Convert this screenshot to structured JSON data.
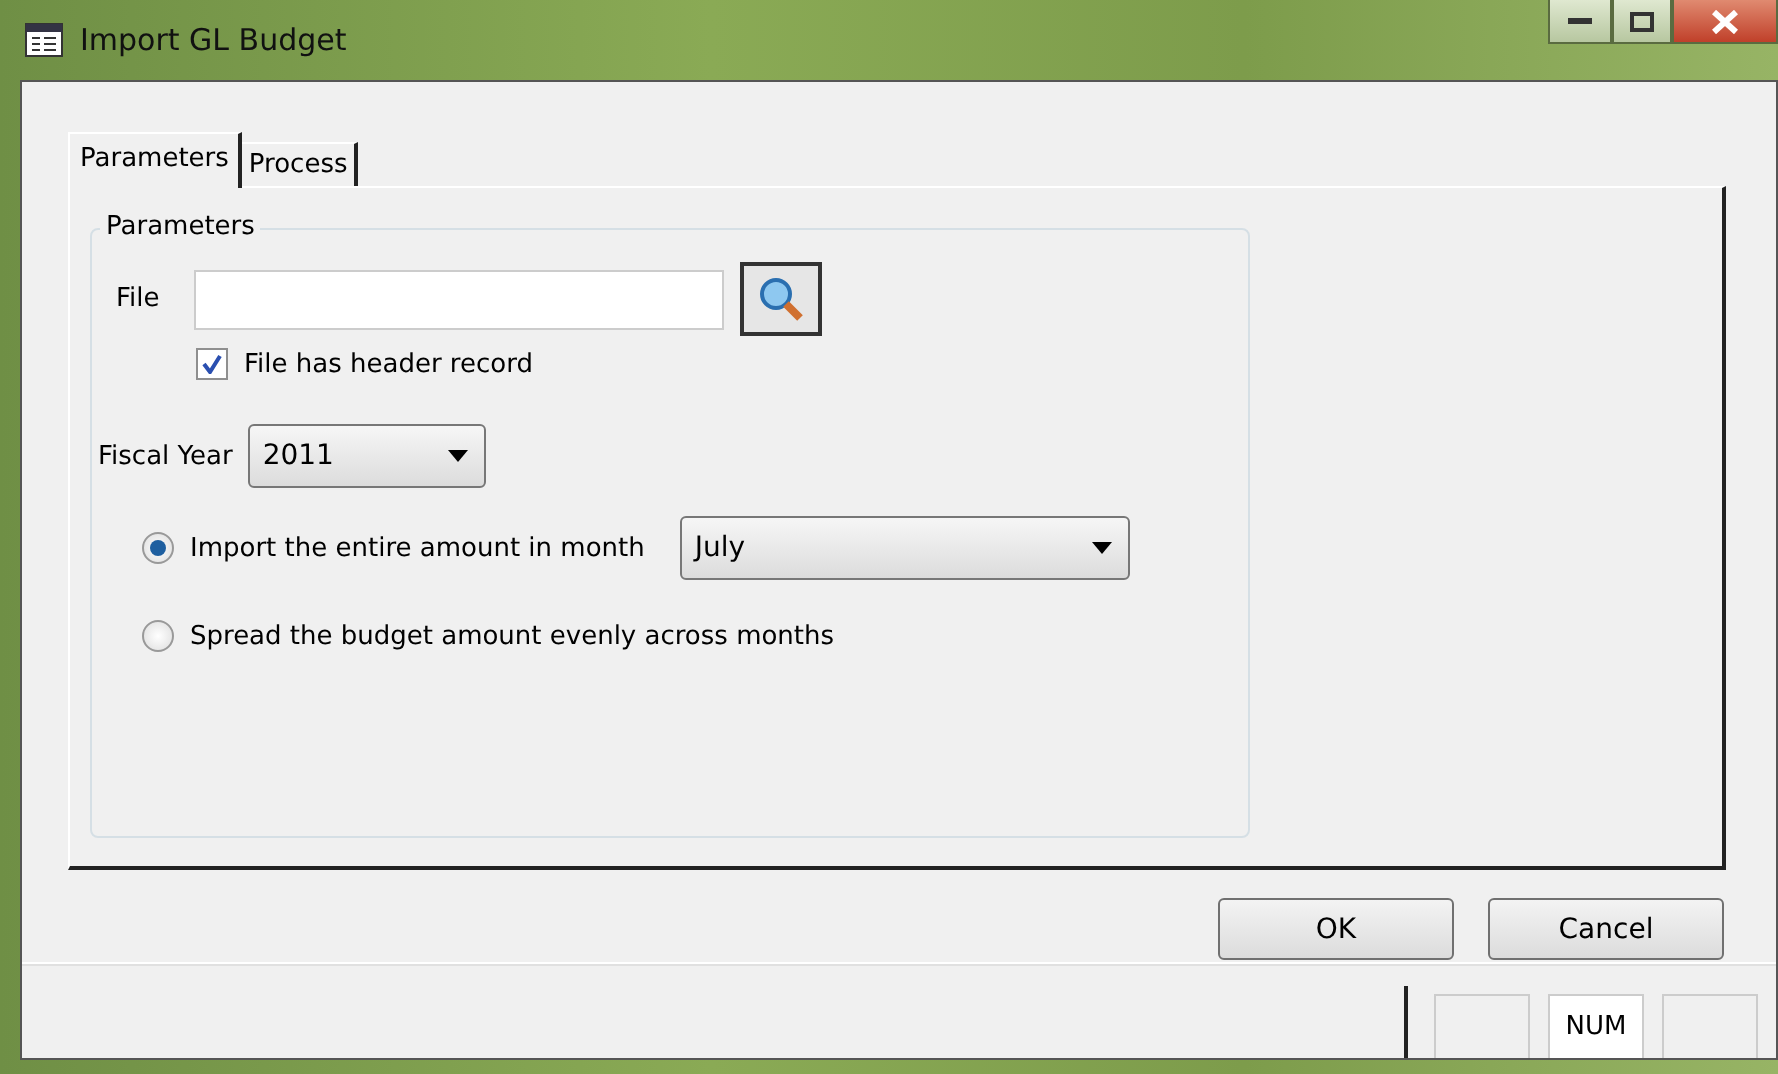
{
  "window": {
    "title": "Import GL Budget"
  },
  "tabs": [
    {
      "label": "Parameters",
      "selected": true
    },
    {
      "label": "Process",
      "selected": false
    }
  ],
  "group": {
    "title": "Parameters"
  },
  "file": {
    "label": "File",
    "header_checkbox": {
      "label": "File has header record",
      "checked": true
    }
  },
  "fiscal_year": {
    "label": "Fiscal Year",
    "value": "2011"
  },
  "options": [
    {
      "label": "Import the entire amount in month",
      "selected": true,
      "month": "July"
    },
    {
      "label": "Spread the budget amount evenly across months",
      "selected": false
    }
  ],
  "buttons": [
    "OK",
    "Cancel"
  ],
  "status_bar": [
    {
      "kind": "empty"
    },
    {
      "kind": "text",
      "text": "NUM"
    },
    {
      "kind": "empty"
    }
  ]
}
